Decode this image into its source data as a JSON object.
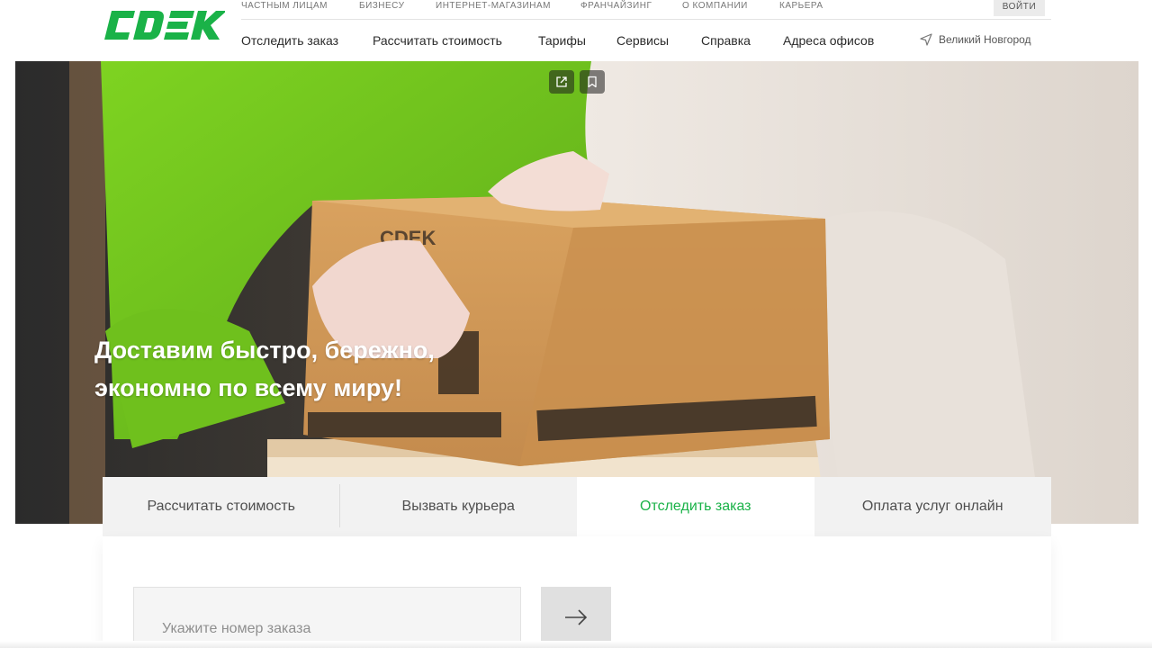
{
  "brand": {
    "logo_text": "CDEK",
    "accent_color": "#1ab248"
  },
  "top_nav": {
    "items": [
      "ЧАСТНЫМ ЛИЦАМ",
      "БИЗНЕСУ",
      "ИНТЕРНЕТ-МАГАЗИНАМ",
      "ФРАНЧАЙЗИНГ",
      "О КОМПАНИИ",
      "КАРЬЕРА"
    ],
    "login_label": "ВОЙТИ"
  },
  "main_nav": {
    "items": [
      "Отследить заказ",
      "Рассчитать стоимость",
      "Тарифы",
      "Сервисы",
      "Справка",
      "Адреса офисов"
    ],
    "city": "Великий Новгород"
  },
  "hero": {
    "title_line1": "Доставим быстро, бережно,",
    "title_line2": "экономно по всему миру!",
    "box_logo": "CDEK"
  },
  "service_tabs": {
    "items": [
      "Рассчитать стоимость",
      "Вызвать курьера",
      "Отследить заказ",
      "Оплата услуг онлайн"
    ],
    "active": "Отследить заказ"
  },
  "tracking": {
    "placeholder": "Укажите номер заказа",
    "value": ""
  }
}
